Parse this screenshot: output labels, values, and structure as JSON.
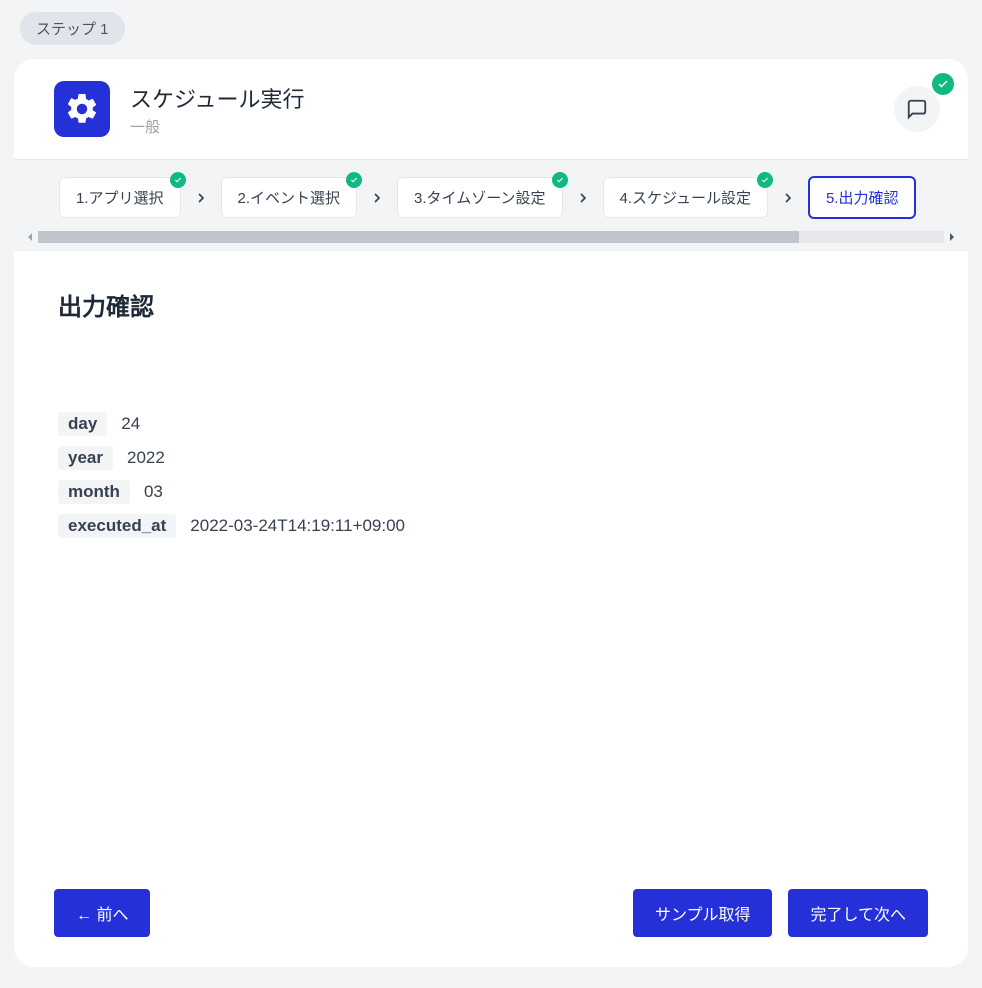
{
  "step_badge": "ステップ  1",
  "header": {
    "title": "スケジュール実行",
    "subtitle": "一般"
  },
  "steps": [
    {
      "label": "1.アプリ選択",
      "done": true,
      "active": false
    },
    {
      "label": "2.イベント選択",
      "done": true,
      "active": false
    },
    {
      "label": "3.タイムゾーン設定",
      "done": true,
      "active": false
    },
    {
      "label": "4.スケジュール設定",
      "done": true,
      "active": false
    },
    {
      "label": "5.出力確認",
      "done": false,
      "active": true
    }
  ],
  "section_title": "出力確認",
  "output": [
    {
      "key": "day",
      "value": "24"
    },
    {
      "key": "year",
      "value": "2022"
    },
    {
      "key": "month",
      "value": "03"
    },
    {
      "key": "executed_at",
      "value": "2022-03-24T14:19:11+09:00"
    }
  ],
  "buttons": {
    "back": "← 前へ",
    "sample": "サンプル取得",
    "next": "完了して次へ"
  }
}
